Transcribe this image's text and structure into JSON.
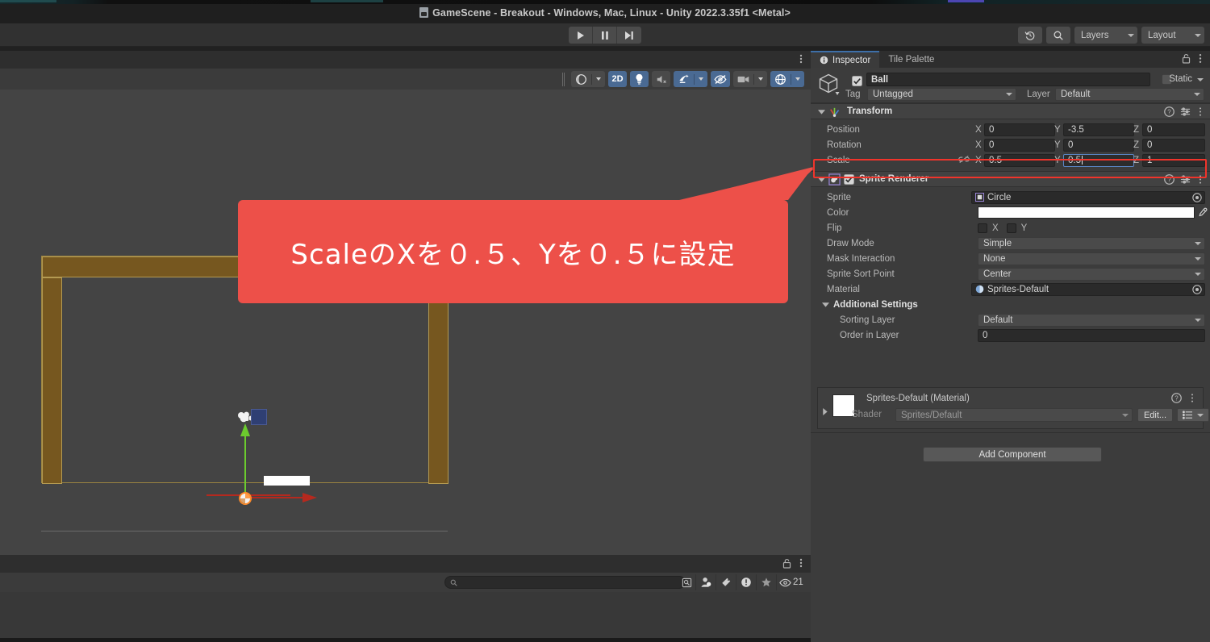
{
  "window": {
    "title": "GameScene - Breakout - Windows, Mac, Linux - Unity 2022.3.35f1 <Metal>",
    "title_icon": "unity-scene-icon"
  },
  "toolbar": {
    "play_label": "play-icon",
    "pause_label": "pause-icon",
    "step_label": "step-icon",
    "history_icon": "undo-history-icon",
    "search_icon": "search-icon",
    "layers_label": "Layers",
    "layout_label": "Layout"
  },
  "scene_toolbar": {
    "items": [
      {
        "name": "shading-mode-dropdown",
        "label": "",
        "icon": "shading-sphere-icon",
        "active": false,
        "dropdown": true
      },
      {
        "name": "toggle-2d",
        "label": "2D",
        "icon": "",
        "active": true,
        "dropdown": false
      },
      {
        "name": "toggle-lighting",
        "label": "",
        "icon": "lightbulb-icon",
        "active": true,
        "dropdown": false
      },
      {
        "name": "toggle-audio",
        "label": "",
        "icon": "audio-mute-icon",
        "active": false,
        "dropdown": false
      },
      {
        "name": "fx-dropdown",
        "label": "",
        "icon": "fx-icon",
        "active": true,
        "dropdown": true
      },
      {
        "name": "toggle-hidden-objects",
        "label": "",
        "icon": "eye-off-icon",
        "active": true,
        "dropdown": false
      },
      {
        "name": "camera-settings",
        "label": "",
        "icon": "camera-icon",
        "active": false,
        "dropdown": true
      },
      {
        "name": "gizmos-dropdown",
        "label": "",
        "icon": "gizmos-globe-icon",
        "active": true,
        "dropdown": true
      }
    ]
  },
  "scene_view": {
    "objects": [
      {
        "name": "wall-top",
        "color": "#76571f"
      },
      {
        "name": "wall-left",
        "color": "#76571f"
      },
      {
        "name": "wall-right",
        "color": "#76571f"
      },
      {
        "name": "paddle",
        "color": "#ffffff"
      },
      {
        "name": "camera-gizmo",
        "color": "#ffffff"
      },
      {
        "name": "move-handle-y",
        "color": "#6ccc2e"
      },
      {
        "name": "move-handle-x",
        "color": "#c0392b"
      },
      {
        "name": "move-handle-xy",
        "color": "#2f3f73"
      },
      {
        "name": "selected-ball",
        "color": "#ff8c2b"
      }
    ]
  },
  "callout": {
    "text": "ScaleのXを０.５、Yを０.５に設定",
    "color": "#ed5049",
    "highlight_color": "#f0342b"
  },
  "inspector": {
    "tabs": [
      {
        "label": "Inspector",
        "icon": "info-icon",
        "active": true
      },
      {
        "label": "Tile Palette",
        "icon": "",
        "active": false
      }
    ],
    "lock_icon": "lock-icon",
    "menu_icon": "kebab-menu-icon",
    "object": {
      "icon": "cube-prefab-icon",
      "enabled": true,
      "name": "Ball",
      "static_label": "Static",
      "static_checked": false,
      "tag_label": "Tag",
      "tag_value": "Untagged",
      "layer_label": "Layer",
      "layer_value": "Default"
    },
    "components": [
      {
        "name": "Transform",
        "icon": "transform-axis-icon",
        "expanded": true,
        "has_toggle": false,
        "rows": [
          {
            "label": "Position",
            "x": "0",
            "y": "-3.5",
            "z": "0"
          },
          {
            "label": "Rotation",
            "x": "0",
            "y": "0",
            "z": "0"
          },
          {
            "label": "Scale",
            "x": "0.5",
            "y": "0.5",
            "z": "1",
            "constrain_icon": "link-broken-icon",
            "focused_axis": "Y",
            "highlighted": true
          }
        ]
      },
      {
        "name": "Sprite Renderer",
        "icon": "sprite-renderer-icon",
        "expanded": true,
        "has_toggle": true,
        "enabled": true,
        "fields": [
          {
            "label": "Sprite",
            "type": "object",
            "value": "Circle",
            "icon": "sprite-asset-icon"
          },
          {
            "label": "Color",
            "type": "color",
            "value": "#ffffff",
            "picker_icon": "eyedropper-icon"
          },
          {
            "label": "Flip",
            "type": "checkboxes",
            "options": [
              "X",
              "Y"
            ],
            "checked": [
              false,
              false
            ]
          },
          {
            "label": "Draw Mode",
            "type": "dropdown",
            "value": "Simple"
          },
          {
            "label": "Mask Interaction",
            "type": "dropdown",
            "value": "None"
          },
          {
            "label": "Sprite Sort Point",
            "type": "dropdown",
            "value": "Center"
          },
          {
            "label": "Material",
            "type": "object",
            "value": "Sprites-Default",
            "icon": "material-asset-icon"
          }
        ],
        "additional_settings": {
          "label": "Additional Settings",
          "expanded": true,
          "fields": [
            {
              "label": "Sorting Layer",
              "type": "dropdown",
              "value": "Default"
            },
            {
              "label": "Order in Layer",
              "type": "text",
              "value": "0"
            }
          ]
        }
      }
    ],
    "material_block": {
      "title": "Sprites-Default (Material)",
      "swatch_color": "#ffffff",
      "shader_label": "Shader",
      "shader_value": "Sprites/Default",
      "edit_label": "Edit...",
      "help_icon": "help-icon",
      "menu_icon": "kebab-menu-icon",
      "preset_icon": "preset-list-icon"
    },
    "add_component_label": "Add Component"
  },
  "bottom_panel": {
    "lock_icon": "lock-icon",
    "menu_icon": "kebab-menu-icon",
    "search_placeholder": "",
    "search_value": "",
    "icons": [
      {
        "name": "save-search-icon"
      },
      {
        "name": "account-icon"
      },
      {
        "name": "tag-icon"
      },
      {
        "name": "error-icon"
      },
      {
        "name": "favorite-star-icon"
      }
    ],
    "visible_count": "21",
    "visible_icon": "eye-icon"
  }
}
